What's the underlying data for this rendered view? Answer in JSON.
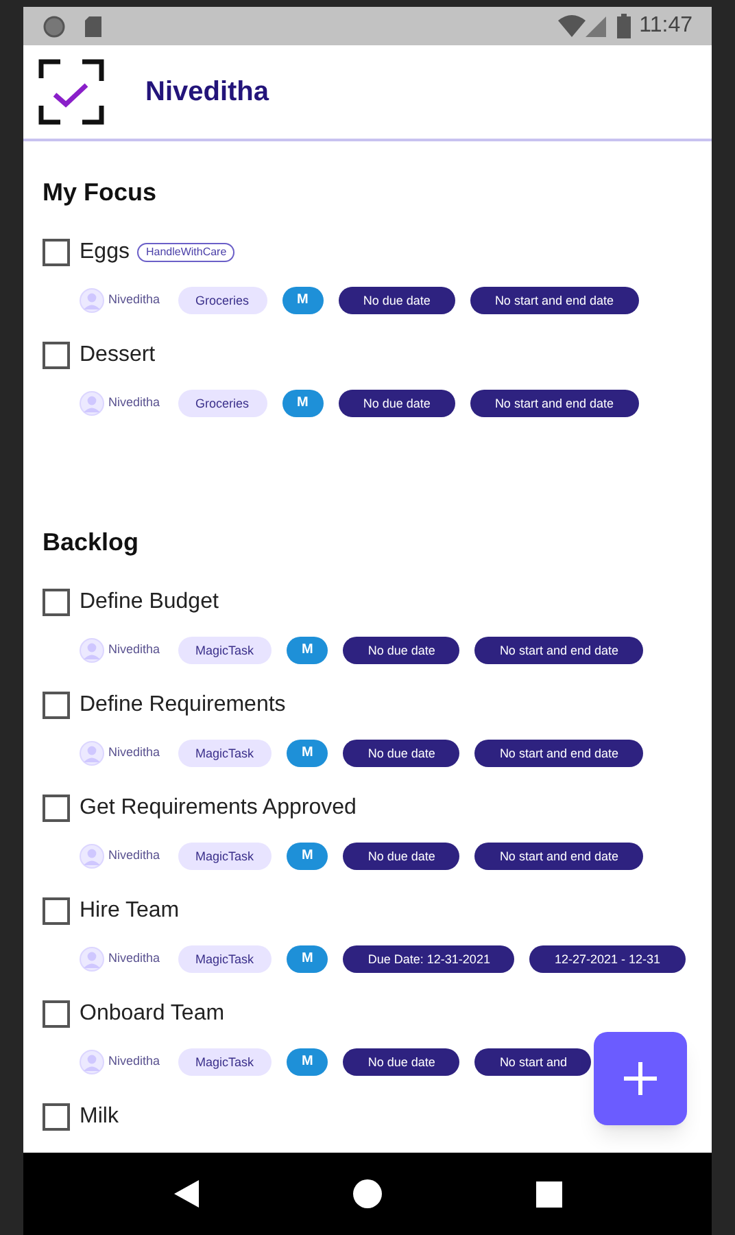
{
  "status_bar": {
    "time": "11:47"
  },
  "header": {
    "title": "Niveditha"
  },
  "sections": [
    {
      "title": "My Focus",
      "tasks": [
        {
          "title": "Eggs",
          "checked": false,
          "tag": "HandleWithCare",
          "assignee": "Niveditha",
          "list": "Groceries",
          "priority": "M",
          "due": "No due date",
          "range": "No start and end date"
        },
        {
          "title": "Dessert",
          "checked": false,
          "assignee": "Niveditha",
          "list": "Groceries",
          "priority": "M",
          "due": "No due date",
          "range": "No start and end date"
        }
      ]
    },
    {
      "title": "Backlog",
      "tasks": [
        {
          "title": "Define Budget",
          "checked": false,
          "assignee": "Niveditha",
          "list": "MagicTask",
          "priority": "M",
          "due": "No due date",
          "range": "No start and end date"
        },
        {
          "title": "Define Requirements",
          "checked": false,
          "assignee": "Niveditha",
          "list": "MagicTask",
          "priority": "M",
          "due": "No due date",
          "range": "No start and end date"
        },
        {
          "title": "Get Requirements Approved",
          "checked": false,
          "assignee": "Niveditha",
          "list": "MagicTask",
          "priority": "M",
          "due": "No due date",
          "range": "No start and end date"
        },
        {
          "title": "Hire Team",
          "checked": false,
          "assignee": "Niveditha",
          "list": "MagicTask",
          "priority": "M",
          "due": "Due Date: 12-31-2021",
          "range": "12-27-2021 - 12-31"
        },
        {
          "title": "Onboard Team",
          "checked": false,
          "assignee": "Niveditha",
          "list": "MagicTask",
          "priority": "M",
          "due": "No due date",
          "range": "No start and"
        },
        {
          "title": "Milk",
          "checked": false
        }
      ]
    }
  ]
}
